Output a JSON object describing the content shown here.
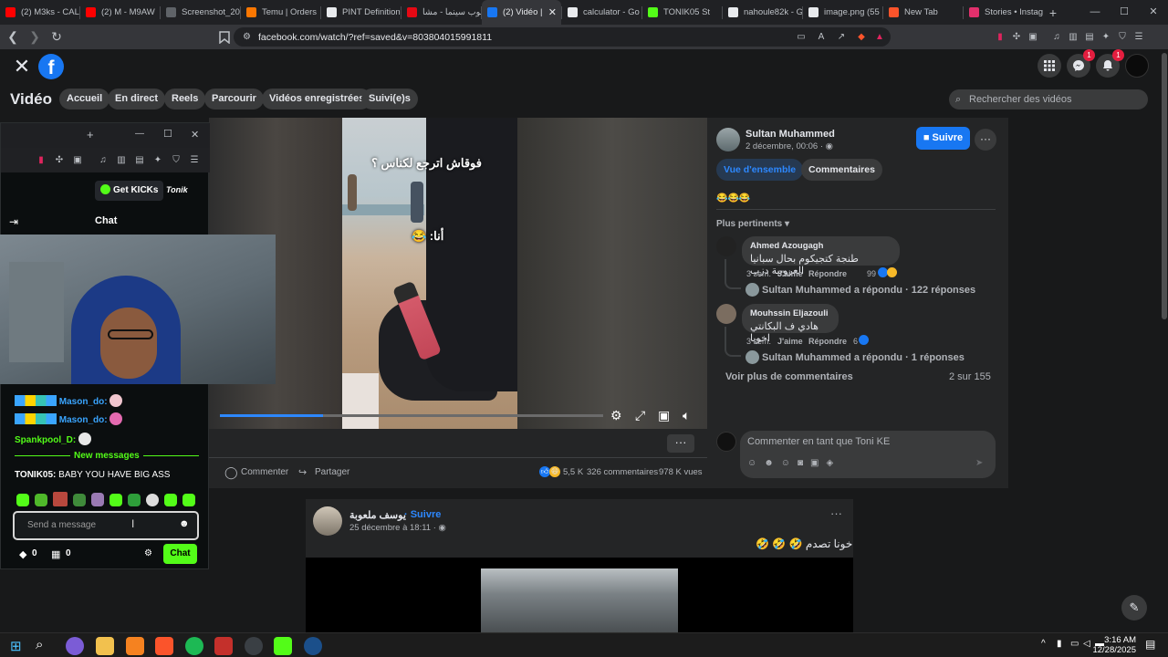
{
  "browser": {
    "tabs": [
      {
        "label": "(2) M3ks - CAL",
        "color": "#ff0000"
      },
      {
        "label": "(2) M - M9AW",
        "color": "#ff0000"
      },
      {
        "label": "Screenshot_20",
        "color": "#5f6368"
      },
      {
        "label": "Temu | Orders",
        "color": "#fb7701"
      },
      {
        "label": "PINT Definition",
        "color": "#e8eaed"
      },
      {
        "label": "توب سينما - مشا",
        "color": "#e50914"
      },
      {
        "label": "(2) Vidéo |",
        "color": "#1877f2",
        "active": true
      },
      {
        "label": "calculator - Go",
        "color": "#e8eaed"
      },
      {
        "label": "TONIK05 St",
        "color": "#53fc18"
      },
      {
        "label": "nahoule82k - G",
        "color": "#e8eaed"
      },
      {
        "label": "image.png (55",
        "color": "#e8eaed"
      },
      {
        "label": "New Tab",
        "color": "#fb542b"
      },
      {
        "label": "Stories • Instag",
        "color": "#e1306c"
      }
    ],
    "url": "facebook.com/watch/?ref=saved&v=803804015991811",
    "new_tab_symbol": "+",
    "close_tab_symbol": "✕"
  },
  "facebook": {
    "logo_letter": "f",
    "nav_title": "Vidéo",
    "nav_pills": [
      "Accueil",
      "En direct",
      "Reels",
      "Parcourir",
      "Vidéos enregistrées",
      "Suivi(e)s"
    ],
    "search_placeholder": "Rechercher des vidéos",
    "messenger_badge": "1",
    "notifications_badge": "1"
  },
  "video": {
    "overlay_top": "فوقاش اترجع لكناس ؟",
    "overlay_mid": "أنا: 😂",
    "progress": 0.27
  },
  "post_actions": {
    "comment": "Commenter",
    "share": "Partager",
    "reactions_count": "5,5 K",
    "comments_count": "326 commentaires",
    "views": "978 K vues"
  },
  "side_panel": {
    "author": "Sultan Muhammed",
    "date": "2 décembre, 00:06 · ",
    "follow": "Suivre",
    "tab_overview": "Vue d'ensemble",
    "tab_comments": "Commentaires",
    "caption": "😂😂😂",
    "sort": "Plus pertinents",
    "comments": [
      {
        "name": "Ahmed Azougagh",
        "text": "طنجة كتجيكوم بحال سبانيا العروبية دزب",
        "time": "3 sem.",
        "like": "J'aime",
        "reply": "Répondre",
        "count": "99",
        "replies": "Sultan Muhammed a répondu · 122 réponses"
      },
      {
        "name": "Mouhssin Eljazouli",
        "text": "هادي ف البكانتي اخويا",
        "time": "3 sem.",
        "like": "J'aime",
        "reply": "Répondre",
        "count": "6",
        "replies": "Sultan Muhammed a répondu · 1 réponses"
      }
    ],
    "more_comments": "Voir plus de commentaires",
    "comments_position": "2 sur 155",
    "comment_placeholder": "Commenter en tant que Toni KE"
  },
  "post2": {
    "author": "يوسف ملعوبة",
    "follow": "· Suivre",
    "date": "25 décembre à 18:11 · ",
    "text": "خونا تصدم 🤣 🤣 🤣"
  },
  "overlay_window": {
    "add": "+",
    "minimize": "—",
    "maximize": "☐",
    "close": "✕",
    "get_kicks": "Get KICKs",
    "brand": "Tonik",
    "chat_title": "Chat",
    "chat_lines": [
      {
        "user": "Mason_do:",
        "color": "#3aa5ff"
      },
      {
        "user": "Mason_do:",
        "color": "#3aa5ff"
      },
      {
        "user": "Spankpool_D:",
        "color": "#53fc18"
      }
    ],
    "new_messages": "New messages",
    "last_message_user": "TONIK05:",
    "last_message_text": "BABY YOU HAVE BIG ASS",
    "input_placeholder": "Send a message",
    "kicks_count": "0",
    "store_count": "0",
    "chat_button": "Chat"
  },
  "taskbar": {
    "time": "3:16 AM",
    "date": "12/28/2025"
  }
}
